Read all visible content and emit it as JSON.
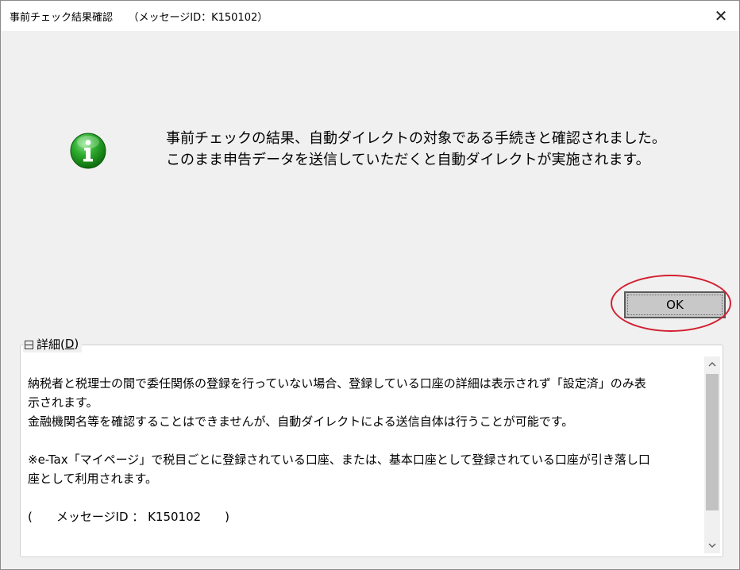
{
  "window": {
    "title": "事前チェック結果確認　　（メッセージID：K150102）",
    "close_glyph": "✕"
  },
  "message": {
    "line1": "事前チェックの結果、自動ダイレクトの対象である手続きと確認されました。",
    "line2": "このまま申告データを送信していただくと自動ダイレクトが実施されます。",
    "icon": "info-icon"
  },
  "ok_button": {
    "label": "OK"
  },
  "details": {
    "toggle": "－",
    "label_prefix": "詳細(",
    "label_key": "D",
    "label_suffix": ")",
    "para1_line1": "納税者と税理士の間で委任関係の登録を行っていない場合、登録している口座の詳細は表示されず「設定済」のみ表",
    "para1_line2": "示されます。",
    "para1_line3": "金融機関名等を確認することはできませんが、自動ダイレクトによる送信自体は行うことが可能です。",
    "para2_line1": "※e-Tax「マイページ」で税目ごとに登録されている口座、または、基本口座として登録されている口座が引き落し口",
    "para2_line2": "座として利用されます。",
    "message_id_line": "(　　メッセージID ： K150102　　)"
  },
  "colors": {
    "accent_annotation": "#d22030",
    "icon_green": "#1f9a1f"
  }
}
